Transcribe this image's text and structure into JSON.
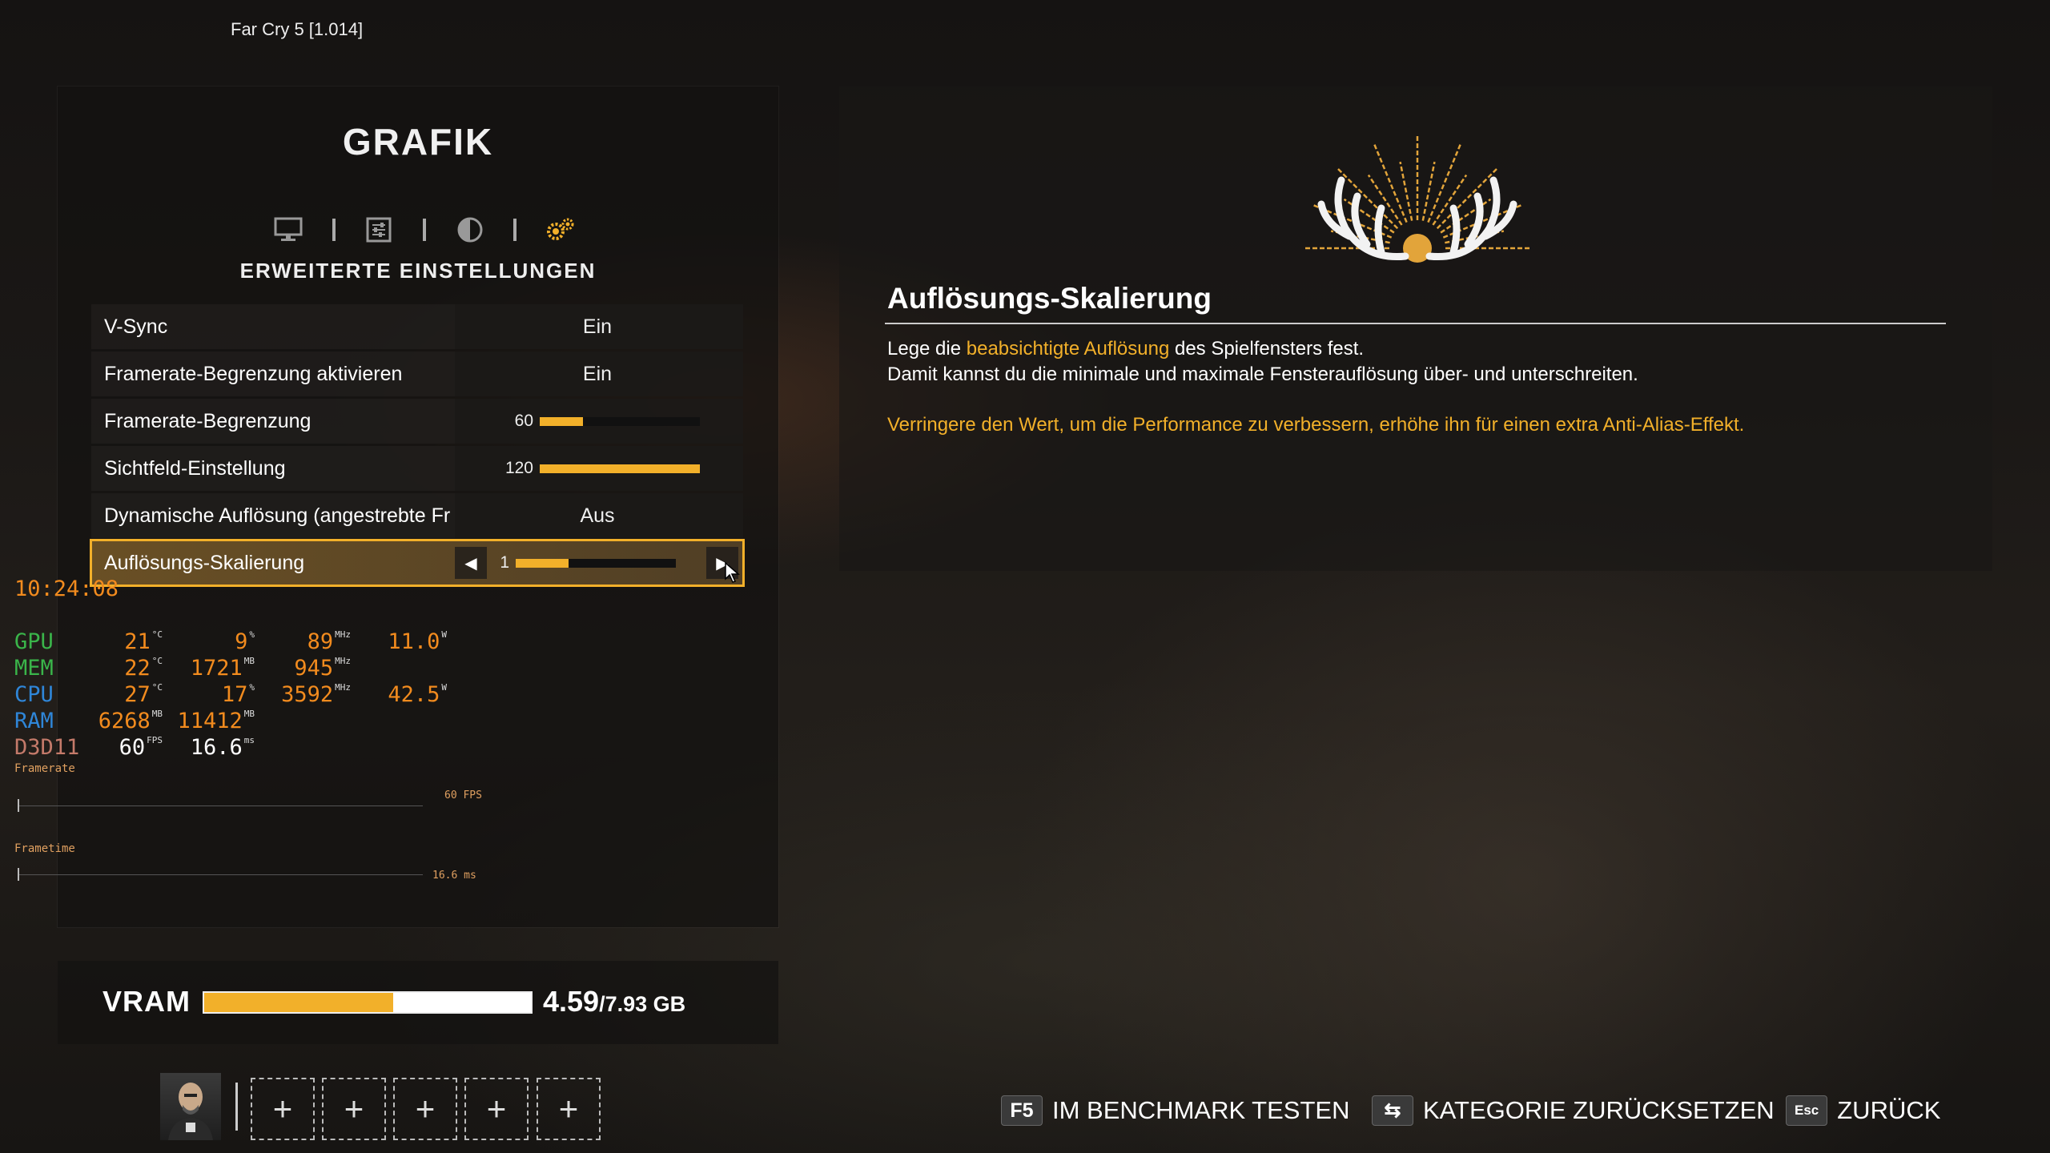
{
  "window": {
    "title": "Far Cry 5 [1.014]"
  },
  "menu": {
    "heading": "GRAFIK",
    "tabs": [
      {
        "icon": "monitor-icon"
      },
      {
        "icon": "sliders-icon"
      },
      {
        "icon": "contrast-icon"
      },
      {
        "icon": "gears-icon",
        "active": true
      }
    ],
    "subtitle": "ERWEITERTE EINSTELLUNGEN",
    "settings": [
      {
        "label": "V-Sync",
        "value": "Ein"
      },
      {
        "label": "Framerate-Begrenzung aktivieren",
        "value": "Ein"
      },
      {
        "label": "Framerate-Begrenzung",
        "value": "60",
        "fill_fraction": 0.27
      },
      {
        "label": "Sichtfeld-Einstellung",
        "value": "120",
        "fill_fraction": 1.0
      },
      {
        "label": "Dynamische Auflösung (angestrebte Fr",
        "value": "Aus"
      },
      {
        "label": "Auflösungs-Skalierung",
        "value": "1",
        "fill_fraction": 0.33,
        "selected": true
      }
    ]
  },
  "overlay": {
    "clock": "10:24:08",
    "rows": [
      {
        "name": "GPU",
        "color": "#3ab54a",
        "c1": "21",
        "u1": "°C",
        "c2": "9",
        "u2": "%",
        "c3": "89",
        "u3": "MHz",
        "c4": "11.0",
        "u4": "W"
      },
      {
        "name": "MEM",
        "color": "#3ab54a",
        "c1": "22",
        "u1": "°C",
        "c2": "1721",
        "u2": "MB",
        "c3": "945",
        "u3": "MHz",
        "c4": "",
        "u4": ""
      },
      {
        "name": "CPU",
        "color": "#2f86d8",
        "c1": "27",
        "u1": "°C",
        "c2": "17",
        "u2": "%",
        "c3": "3592",
        "u3": "MHz",
        "c4": "42.5",
        "u4": "W"
      },
      {
        "name": "RAM",
        "color": "#2f86d8",
        "c1": "6268",
        "u1": "MB",
        "c2": "11412",
        "u2": "MB",
        "c3": "",
        "u3": "",
        "c4": "",
        "u4": ""
      },
      {
        "name": "D3D11",
        "color": "#c47a6a",
        "c1": "60",
        "u1": "FPS",
        "c2": "16.6",
        "u2": "ms",
        "c3": "",
        "u3": "",
        "c4": "",
        "u4": ""
      }
    ],
    "framerate_label": "Framerate",
    "framerate_ref": "60 FPS",
    "frametime_label": "Frametime",
    "frametime_ref": "16.6 ms"
  },
  "vram": {
    "label": "VRAM",
    "used": "4.59",
    "total": "/7.93 GB",
    "fill_fraction": 0.579
  },
  "detail": {
    "title": "Auflösungs-Skalierung",
    "line1_pre": "Lege die ",
    "line1_hl": "beabsichtigte Auflösung",
    "line1_post": " des Spielfensters fest.",
    "line2": "Damit kannst du die minimale und maximale Fensterauflösung über- und unterschreiten.",
    "line3": "Verringere den Wert, um die Performance zu verbessern, erhöhe ihn für einen extra Anti-Alias-Effekt."
  },
  "prompts": [
    {
      "key": "F5",
      "label": "IM BENCHMARK TESTEN"
    },
    {
      "key": "⇆",
      "label": "KATEGORIE ZURÜCKSETZEN"
    },
    {
      "key": "Esc",
      "label": "ZURÜCK"
    }
  ],
  "slots": {
    "empty_symbol": "+"
  }
}
